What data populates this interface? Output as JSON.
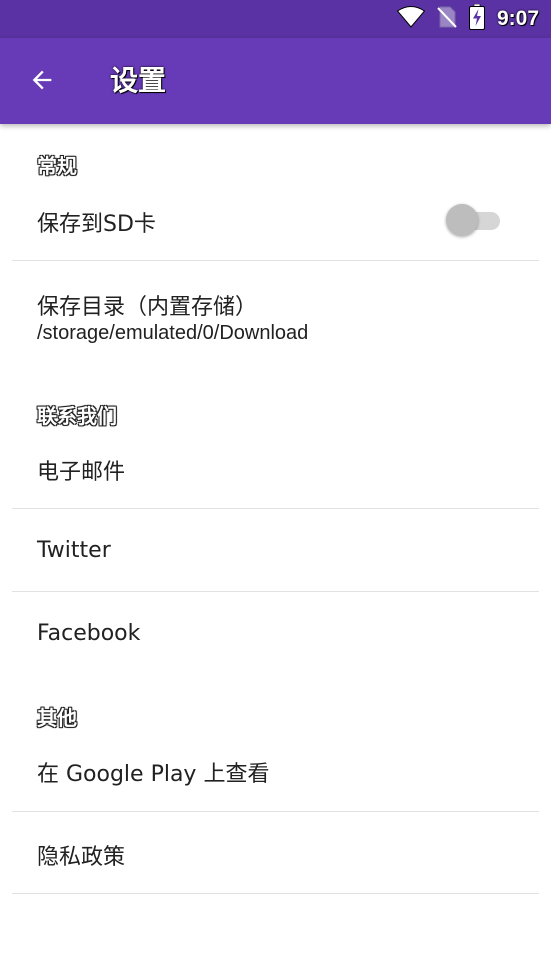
{
  "status_bar": {
    "time": "9:07",
    "icons": [
      "wifi-icon",
      "no-sim-icon",
      "battery-charging-icon"
    ],
    "color": "#5a32a3"
  },
  "app_bar": {
    "title": "设置",
    "back_icon": "arrow-left-icon",
    "color": "#673ab7"
  },
  "sections": {
    "general": {
      "header": "常规",
      "save_to_sd": {
        "title": "保存到SD卡",
        "enabled": false
      },
      "save_dir": {
        "title": "保存目录（内置存储）",
        "path": "/storage/emulated/0/Download"
      }
    },
    "contact": {
      "header": "联系我们",
      "email": "电子邮件",
      "twitter": "Twitter",
      "facebook": "Facebook"
    },
    "other": {
      "header": "其他",
      "google_play": "在 Google Play 上查看",
      "privacy": "隐私政策"
    }
  }
}
